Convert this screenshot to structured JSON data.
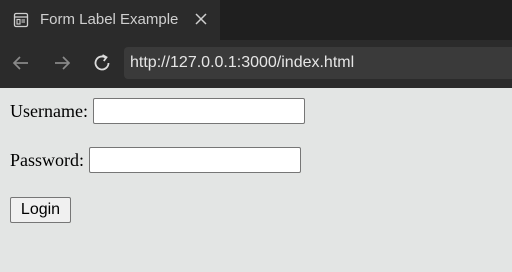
{
  "browser": {
    "tab": {
      "title": "Form Label Example",
      "icon": "page-icon",
      "close_icon": "close-icon"
    },
    "nav": {
      "back_icon": "back-arrow-icon",
      "forward_icon": "forward-arrow-icon",
      "reload_icon": "reload-icon"
    },
    "address": {
      "url": "http://127.0.0.1:3000/index.html"
    },
    "colors": {
      "chrome_dark": "#1f1f1f",
      "chrome_tab": "#2b2b2b",
      "urlbar_bg": "#3a3a3a",
      "page_bg": "#e3e5e4"
    }
  },
  "form": {
    "username": {
      "label": "Username:",
      "value": ""
    },
    "password": {
      "label": "Password:",
      "value": ""
    },
    "login_button": {
      "label": "Login"
    }
  }
}
